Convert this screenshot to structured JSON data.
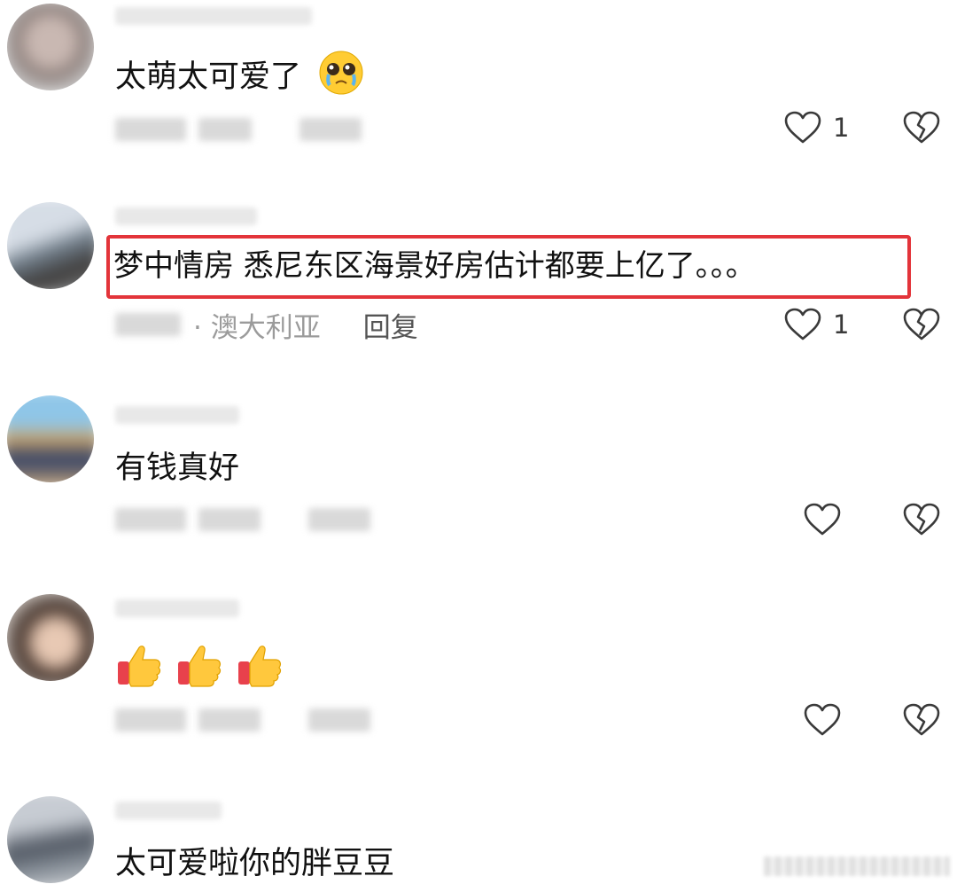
{
  "comments": [
    {
      "text": "太萌太可爱了",
      "emoji": "pleading-face-emoji",
      "meta_location": "",
      "reply_label": "",
      "likes": "1"
    },
    {
      "text": "梦中情房 悉尼东区海景好房估计都要上亿了。。。",
      "meta_location": "· 澳大利亚",
      "reply_label": "回复",
      "likes": "1",
      "highlighted": true
    },
    {
      "text": "有钱真好",
      "meta_location": "",
      "reply_label": "",
      "likes": ""
    },
    {
      "text": "",
      "emoji": [
        "thumbs-up-emoji",
        "thumbs-up-emoji",
        "thumbs-up-emoji"
      ],
      "meta_location": "",
      "reply_label": "",
      "likes": ""
    },
    {
      "text": "太可爱啦你的胖豆豆",
      "meta_location": "",
      "reply_label": "",
      "likes": ""
    }
  ],
  "icons": {
    "like": "heart-outline-icon",
    "dislike": "broken-heart-icon"
  },
  "colors": {
    "highlight_border": "#e3343a",
    "meta_text": "#9b9b9b",
    "icon_stroke": "#3a3a3a"
  }
}
